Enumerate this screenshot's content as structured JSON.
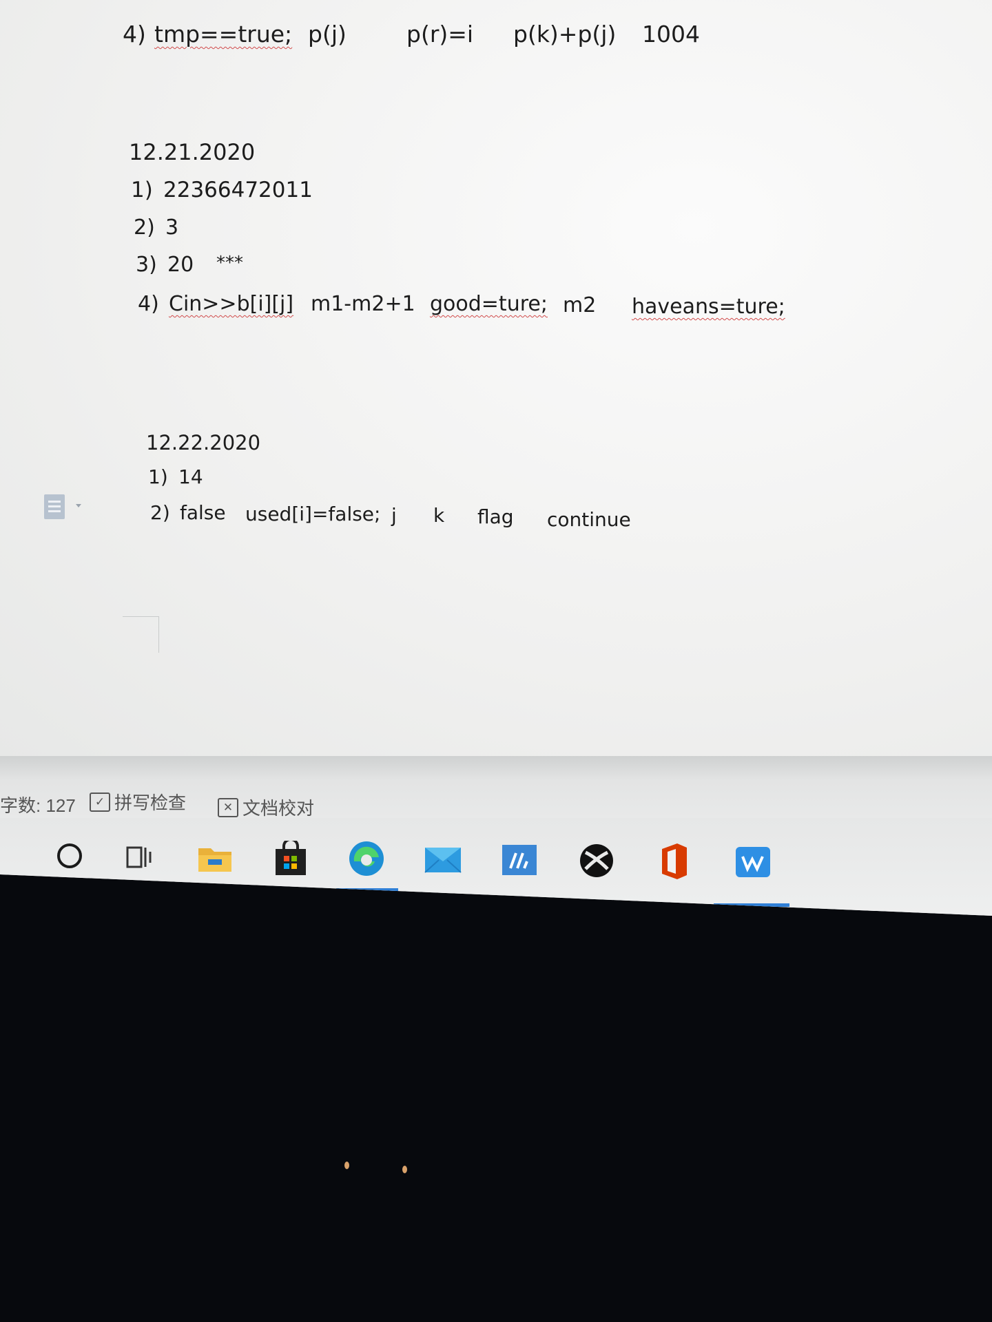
{
  "document": {
    "top_line": {
      "num": "4)",
      "answers": [
        "tmp==true;",
        "p(j)",
        "p(r)=i",
        "p(k)+p(j)",
        "1004"
      ]
    },
    "section_1": {
      "date": "12.21.2020",
      "items": [
        {
          "num": "1)",
          "text": "22366472011"
        },
        {
          "num": "2)",
          "text": "3"
        },
        {
          "num": "3)",
          "text": "20",
          "extra": "***"
        },
        {
          "num": "4)",
          "answers": [
            "Cin>>b[i][j]",
            "m1-m2+1",
            "good=ture;",
            "m2",
            "haveans=ture;"
          ]
        }
      ]
    },
    "section_2": {
      "date": "12.22.2020",
      "items": [
        {
          "num": "1)",
          "text": "14"
        },
        {
          "num": "2)",
          "answers": [
            "false",
            "used[i]=false;",
            "j",
            "k",
            "flag",
            "continue"
          ]
        }
      ]
    }
  },
  "statusbar": {
    "word_count": "字数: 127",
    "spell_check": "拼写检查",
    "doc_proofread": "文档校对"
  },
  "taskbar": {
    "icons": [
      "cortana-icon",
      "task-view-icon",
      "file-explorer-icon",
      "microsoft-store-icon",
      "edge-icon",
      "mail-icon",
      "app-ia-icon",
      "xbox-icon",
      "office-icon",
      "wps-icon"
    ],
    "accent": "#2f7fd6"
  }
}
